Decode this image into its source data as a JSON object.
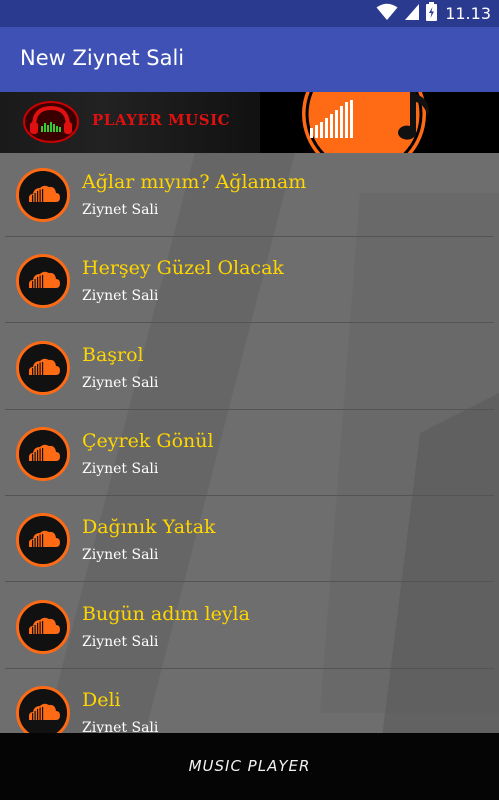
{
  "status_bar": {
    "time": "11.13",
    "icons": [
      "wifi-icon",
      "signal-icon",
      "battery-icon"
    ]
  },
  "app_bar": {
    "title": "New Ziynet Sali"
  },
  "banner": {
    "text": "PLAYER MUSIC"
  },
  "songs": [
    {
      "title": "Ağlar mıyım? Ağlamam",
      "artist": "Ziynet Sali"
    },
    {
      "title": "Herşey Güzel Olacak",
      "artist": "Ziynet Sali"
    },
    {
      "title": "Başrol",
      "artist": "Ziynet Sali"
    },
    {
      "title": "Çeyrek Gönül",
      "artist": "Ziynet Sali"
    },
    {
      "title": "Dağınık Yatak",
      "artist": "Ziynet Sali"
    },
    {
      "title": "Bugün adım leyla",
      "artist": "Ziynet Sali"
    },
    {
      "title": "Deli",
      "artist": "Ziynet Sali"
    }
  ],
  "footer": {
    "label": "MUSIC PLAYER"
  },
  "colors": {
    "status_bar": "#2a3b8f",
    "app_bar": "#3f51b5",
    "song_title": "#ffd600",
    "accent_orange": "#ff6a14",
    "banner_text": "#e01010"
  }
}
